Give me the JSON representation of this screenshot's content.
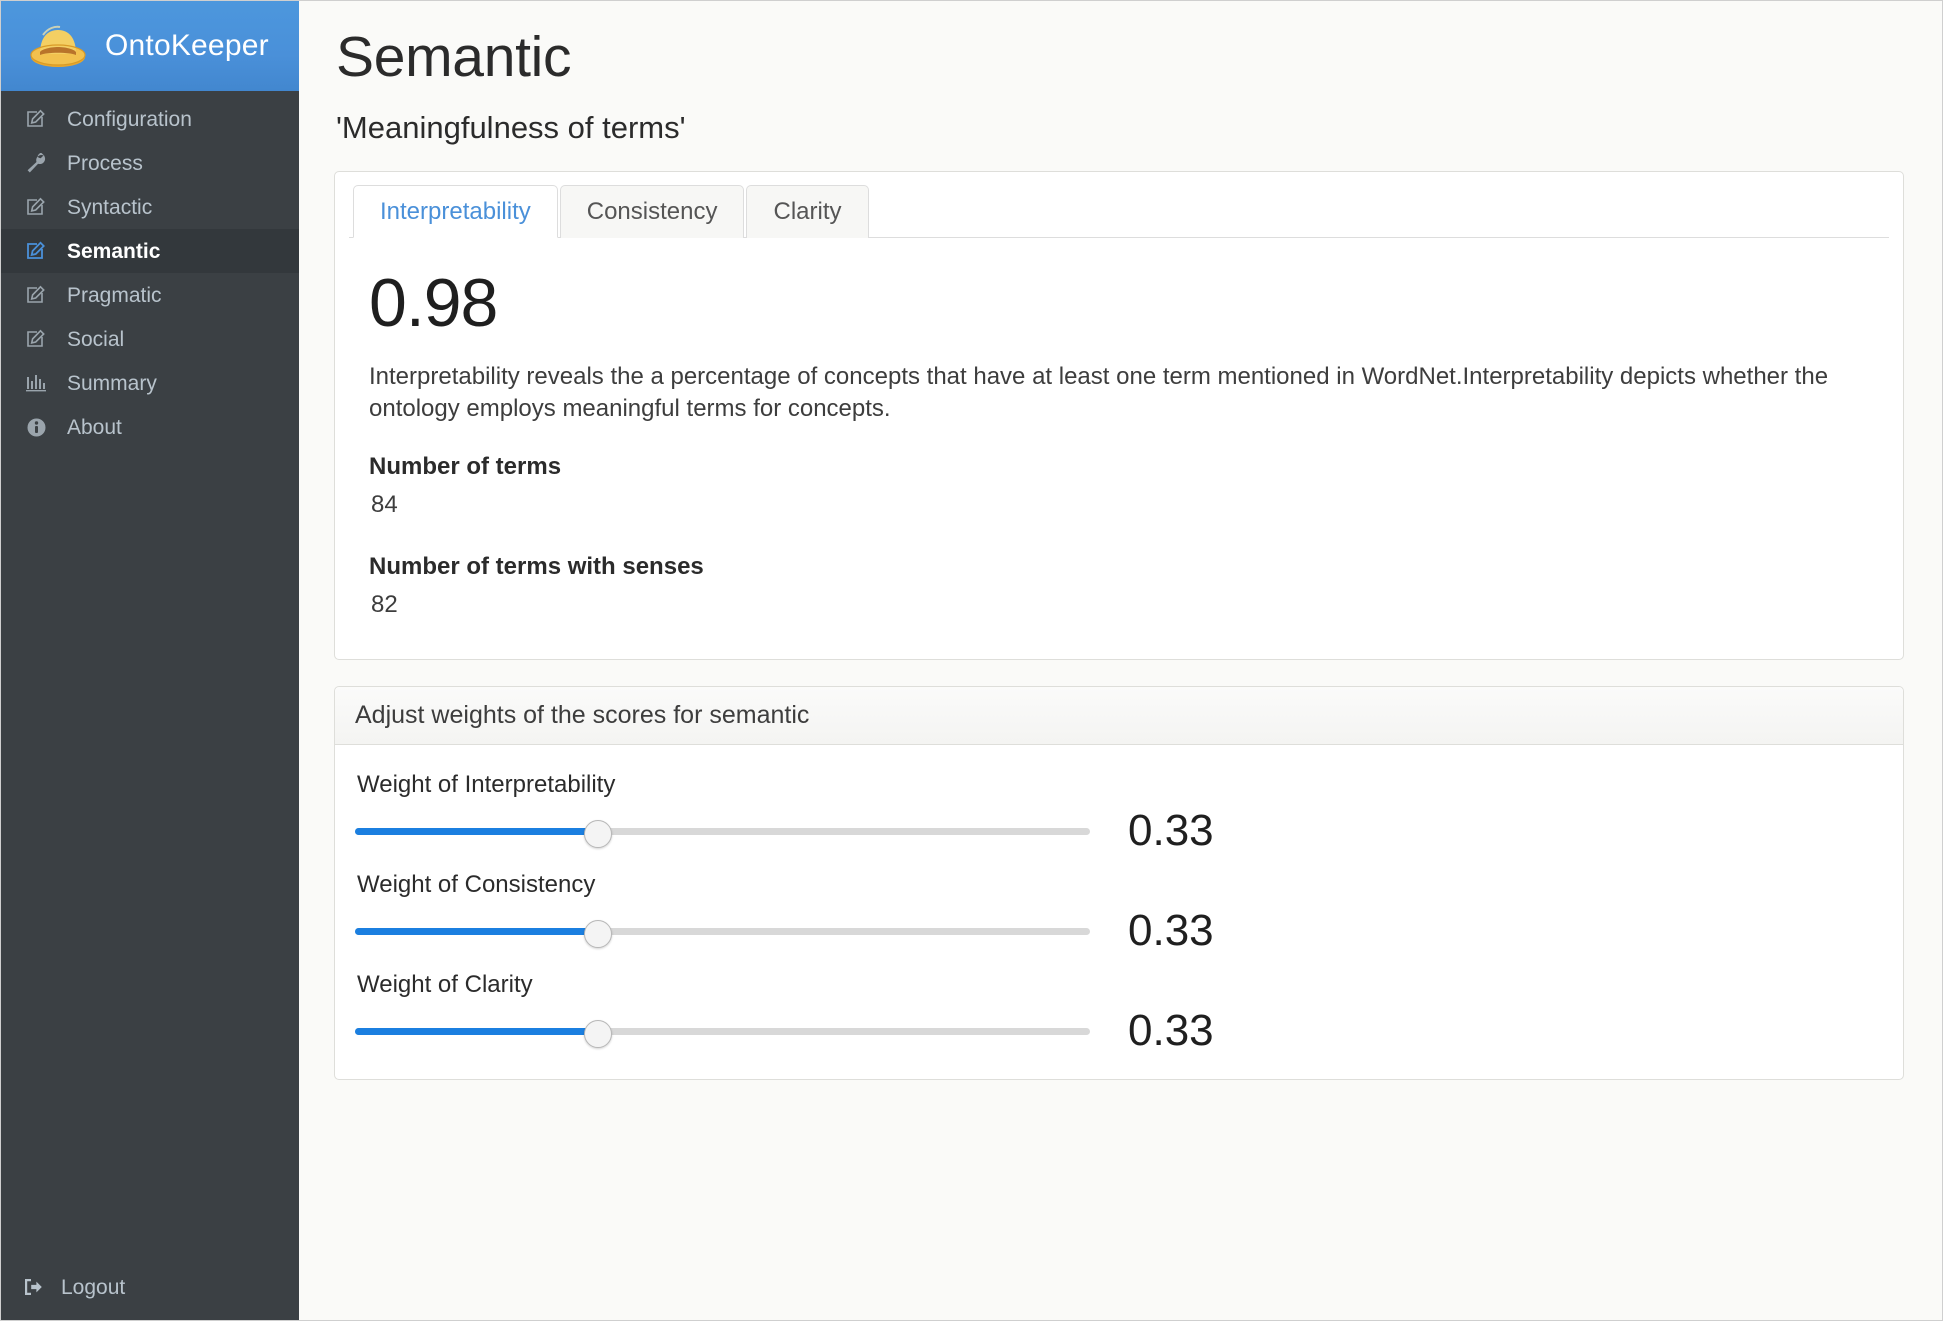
{
  "brand": {
    "name": "OntoKeeper",
    "logo_icon": "straw-hat-icon",
    "header_color": "#4a90d9"
  },
  "sidebar": {
    "background_color": "#3b4044",
    "items": [
      {
        "label": "Configuration",
        "icon": "edit-square-icon",
        "active": false
      },
      {
        "label": "Process",
        "icon": "wrench-icon",
        "active": false
      },
      {
        "label": "Syntactic",
        "icon": "edit-square-icon",
        "active": false
      },
      {
        "label": "Semantic",
        "icon": "edit-square-icon",
        "active": true
      },
      {
        "label": "Pragmatic",
        "icon": "edit-square-icon",
        "active": false
      },
      {
        "label": "Social",
        "icon": "edit-square-icon",
        "active": false
      },
      {
        "label": "Summary",
        "icon": "bar-chart-icon",
        "active": false
      },
      {
        "label": "About",
        "icon": "info-circle-icon",
        "active": false
      }
    ],
    "logout": {
      "label": "Logout",
      "icon": "sign-out-icon"
    }
  },
  "page": {
    "title": "Semantic",
    "subtitle": "'Meaningfulness of terms'"
  },
  "tabs": [
    {
      "label": "Interpretability",
      "active": true
    },
    {
      "label": "Consistency",
      "active": false
    },
    {
      "label": "Clarity",
      "active": false
    }
  ],
  "metric": {
    "score": "0.98",
    "description": "Interpretability reveals the a percentage of concepts that have at least one term mentioned in WordNet.Interpretability depicts whether the ontology employs meaningful terms for concepts.",
    "fields": [
      {
        "label": "Number of terms",
        "value": "84"
      },
      {
        "label": "Number of terms with senses",
        "value": "82"
      }
    ]
  },
  "weights": {
    "heading": "Adjust weights of the scores for semantic",
    "accent_color": "#1b7fe0",
    "rows": [
      {
        "label": "Weight of Interpretability",
        "value": "0.33",
        "percent": 33
      },
      {
        "label": "Weight of Consistency",
        "value": "0.33",
        "percent": 33
      },
      {
        "label": "Weight of Clarity",
        "value": "0.33",
        "percent": 33
      }
    ]
  }
}
